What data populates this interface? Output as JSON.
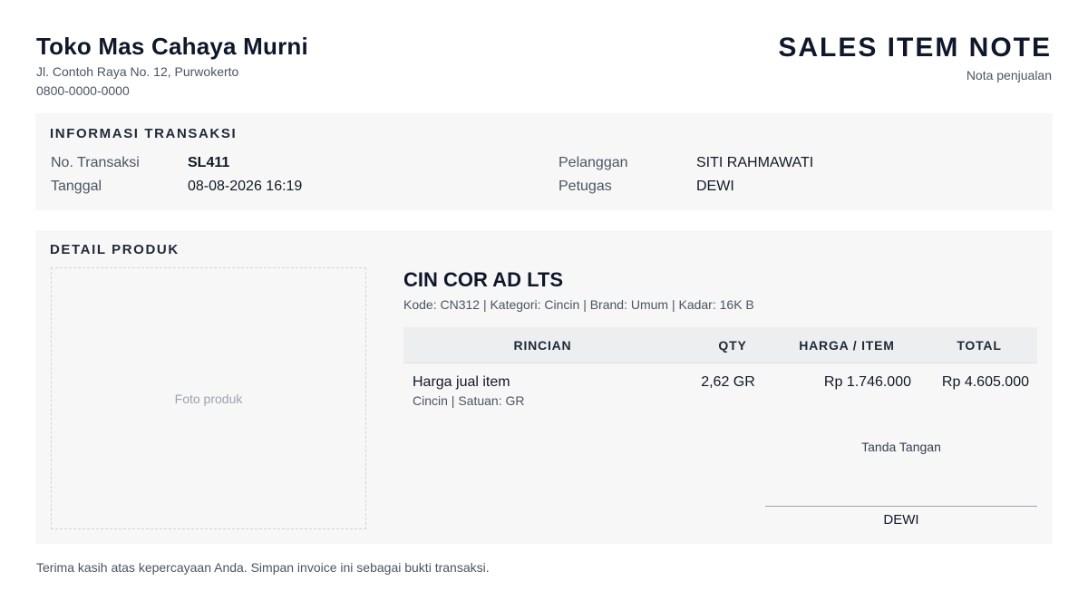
{
  "store": {
    "name": "Toko Mas Cahaya Murni",
    "address": "Jl. Contoh Raya No. 12, Purwokerto",
    "phone": "0800-0000-0000"
  },
  "document": {
    "title": "SALES ITEM NOTE",
    "subtitle": "Nota penjualan"
  },
  "transaction": {
    "section_title": "INFORMASI TRANSAKSI",
    "number_label": "No. Transaksi",
    "number": "SL411",
    "date_label": "Tanggal",
    "date": "08-08-2026 16:19",
    "customer_label": "Pelanggan",
    "customer": "SITI RAHMAWATI",
    "staff_label": "Petugas",
    "staff": "DEWI"
  },
  "product": {
    "section_title": "DETAIL PRODUK",
    "photo_placeholder": "Foto produk",
    "name": "CIN COR AD LTS",
    "meta": "Kode: CN312 | Kategori: Cincin | Brand: Umum | Kadar: 16K B",
    "table": {
      "headers": [
        "RINCIAN",
        "QTY",
        "HARGA / ITEM",
        "TOTAL"
      ],
      "rows": [
        {
          "item": "Harga jual item",
          "sub": "Cincin | Satuan: GR",
          "qty": "2,62 GR",
          "price": "Rp 1.746.000",
          "total": "Rp 4.605.000"
        }
      ]
    },
    "signature_label": "Tanda Tangan",
    "signature_name": "DEWI"
  },
  "footer": "Terima kasih atas kepercayaan Anda. Simpan invoice ini sebagai bukti transaksi."
}
